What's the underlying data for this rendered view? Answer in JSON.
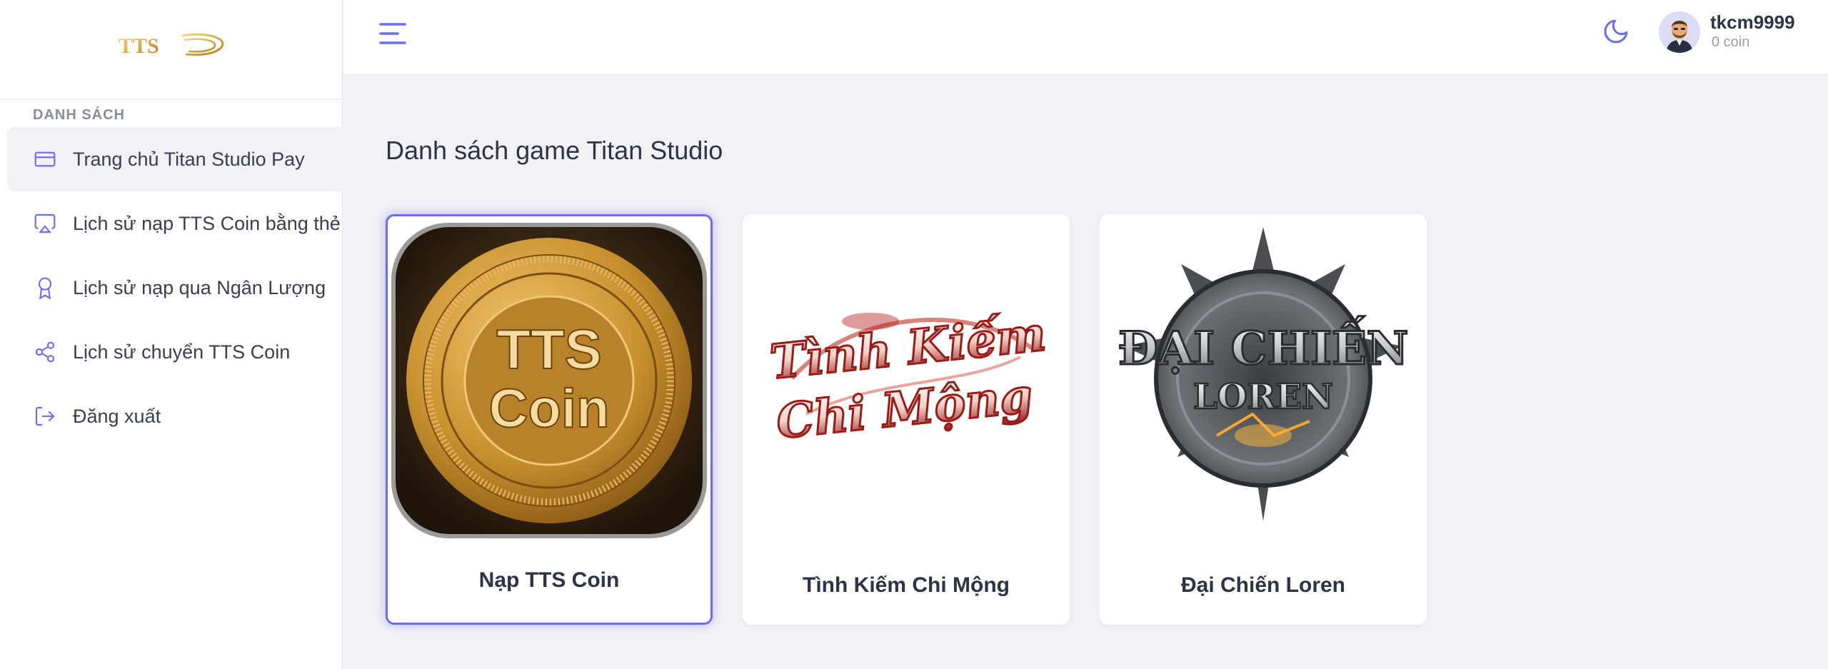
{
  "brand": {
    "logo_text": "TTS"
  },
  "sidebar": {
    "section_title": "DANH SÁCH",
    "items": [
      {
        "label": "Trang chủ Titan Studio Pay",
        "icon": "credit-card-icon",
        "active": true
      },
      {
        "label": "Lịch sử nạp TTS Coin bằng thẻ",
        "icon": "airplay-icon",
        "active": false
      },
      {
        "label": "Lịch sử nạp qua Ngân Lượng",
        "icon": "award-icon",
        "active": false
      },
      {
        "label": "Lịch sử chuyển TTS Coin",
        "icon": "share-icon",
        "active": false
      },
      {
        "label": "Đăng xuất",
        "icon": "log-out-icon",
        "active": false
      }
    ]
  },
  "topbar": {
    "user": {
      "name": "tkcm9999",
      "coin": "0 coin"
    }
  },
  "main": {
    "title": "Danh sách game Titan Studio",
    "games": [
      {
        "name": "Nạp TTS Coin",
        "image_text": [
          "TTS",
          "Coin"
        ],
        "selected": true
      },
      {
        "name": "Tình Kiếm Chi Mộng",
        "image_text": [
          "Tình Kiếm",
          "Chi Mộng"
        ],
        "selected": false
      },
      {
        "name": "Đại Chiến Loren",
        "image_text": [
          "ĐẠI CHIẾN",
          "LOREN"
        ],
        "selected": false
      }
    ]
  },
  "colors": {
    "accent": "#6c6cf4",
    "text": "#2f3349",
    "gold": "#c8912e",
    "red": "#b3201e"
  }
}
